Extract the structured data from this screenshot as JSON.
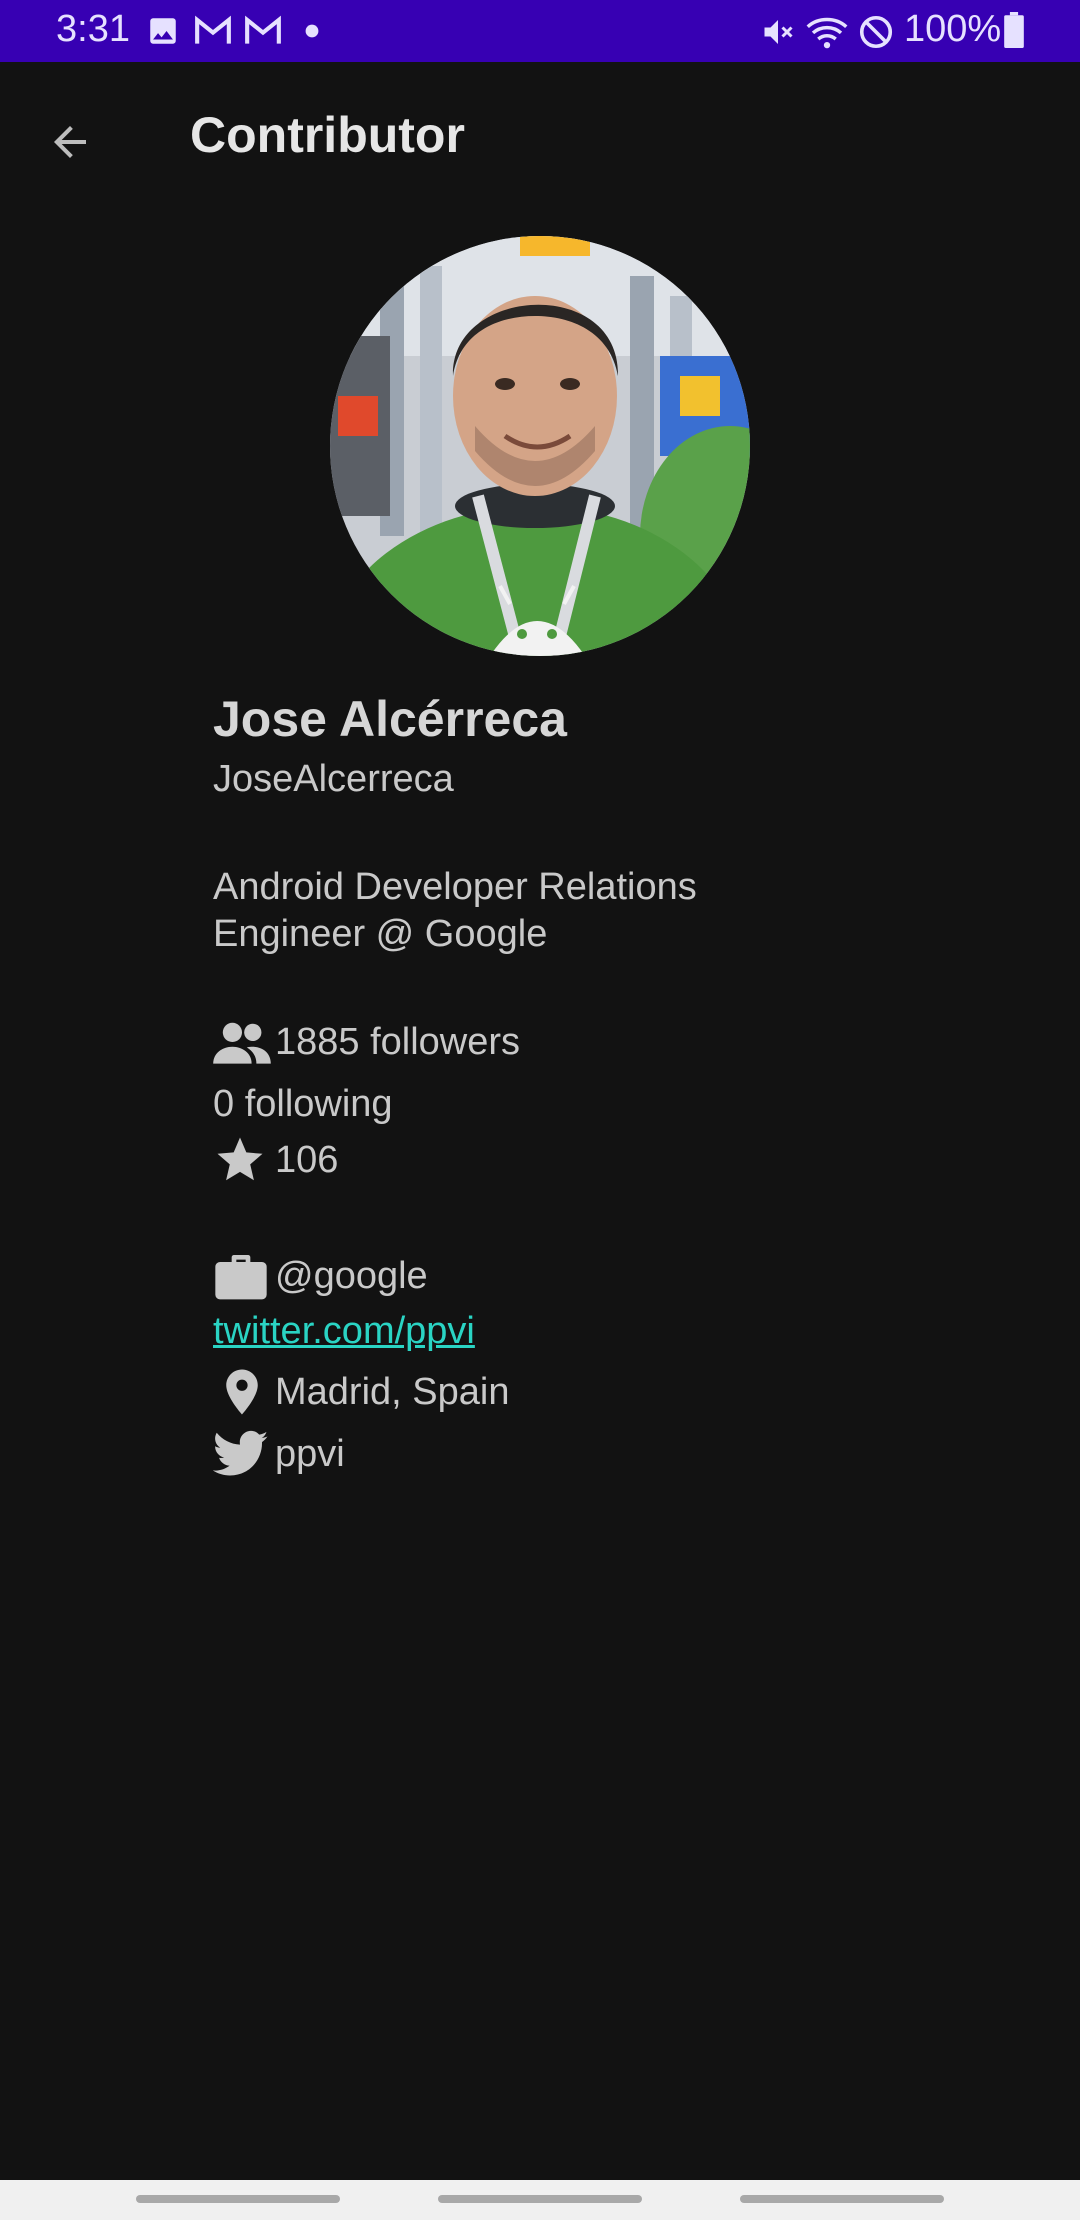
{
  "status_bar": {
    "time": "3:31",
    "battery": "100%",
    "icons": [
      "image-icon",
      "gmail-icon",
      "gmail-icon",
      "dot-icon",
      "mute-icon",
      "wifi-icon",
      "do-not-disturb-icon",
      "battery-icon"
    ]
  },
  "app_bar": {
    "title": "Contributor",
    "back_icon": "arrow-back-icon"
  },
  "profile": {
    "name": "Jose Alcérreca",
    "login": "JoseAlcerreca",
    "bio": "Android Developer Relations Engineer @ Google",
    "followers": "1885 followers",
    "following": "0 following",
    "stars": "106",
    "company": "@google",
    "blog": "twitter.com/ppvi",
    "location": "Madrid, Spain",
    "twitter": "ppvi"
  },
  "colors": {
    "status_bar": "#3700b3",
    "background": "#121212",
    "link": "#2ad4c4"
  }
}
